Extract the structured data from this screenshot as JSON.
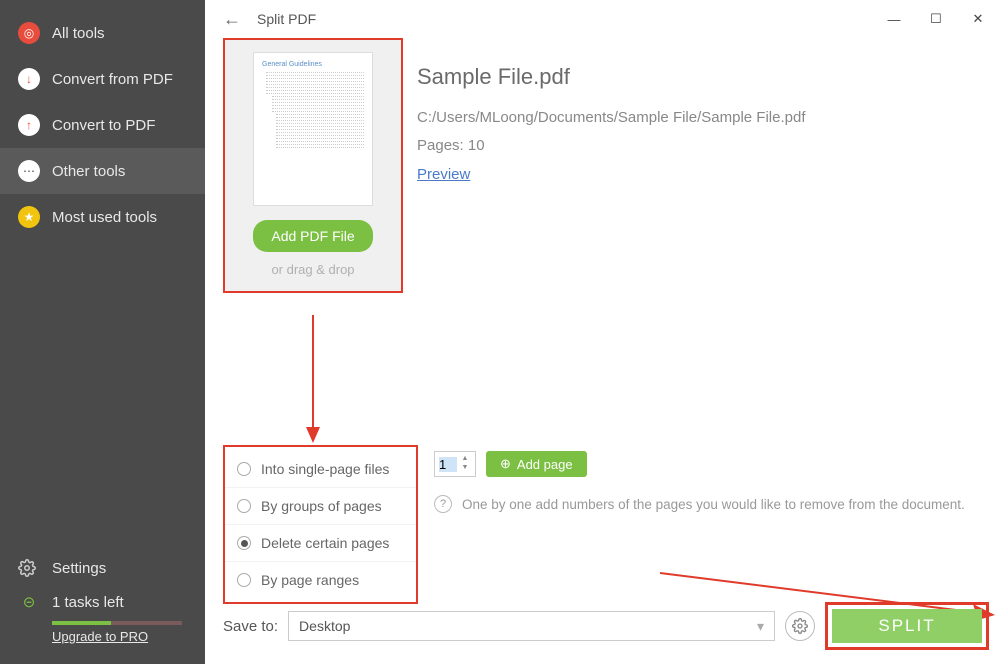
{
  "sidebar": {
    "items": [
      {
        "label": "All tools",
        "icon": "target-icon"
      },
      {
        "label": "Convert from PDF",
        "icon": "arrow-down-icon"
      },
      {
        "label": "Convert to PDF",
        "icon": "arrow-up-icon"
      },
      {
        "label": "Other tools",
        "icon": "dots-icon"
      },
      {
        "label": "Most used tools",
        "icon": "star-icon"
      }
    ],
    "settings_label": "Settings",
    "tasks_label": "1 tasks left",
    "upgrade_label": "Upgrade to PRO"
  },
  "titlebar": {
    "title": "Split PDF"
  },
  "file": {
    "name": "Sample File.pdf",
    "path": "C:/Users/MLoong/Documents/Sample File/Sample File.pdf",
    "pages_label": "Pages: 10",
    "preview_label": "Preview",
    "thumb_title": "General Guidelines",
    "add_btn": "Add PDF File",
    "drag_label": "or drag & drop"
  },
  "options": {
    "items": [
      "Into single-page files",
      "By groups of pages",
      "Delete certain pages",
      "By page ranges"
    ],
    "selected_index": 2,
    "page_value": "1",
    "add_page_btn": "Add page",
    "hint": "One by one add numbers of the pages you would like to remove from the document."
  },
  "bottom": {
    "save_label": "Save to:",
    "save_value": "Desktop",
    "split_btn": "SPLIT"
  }
}
